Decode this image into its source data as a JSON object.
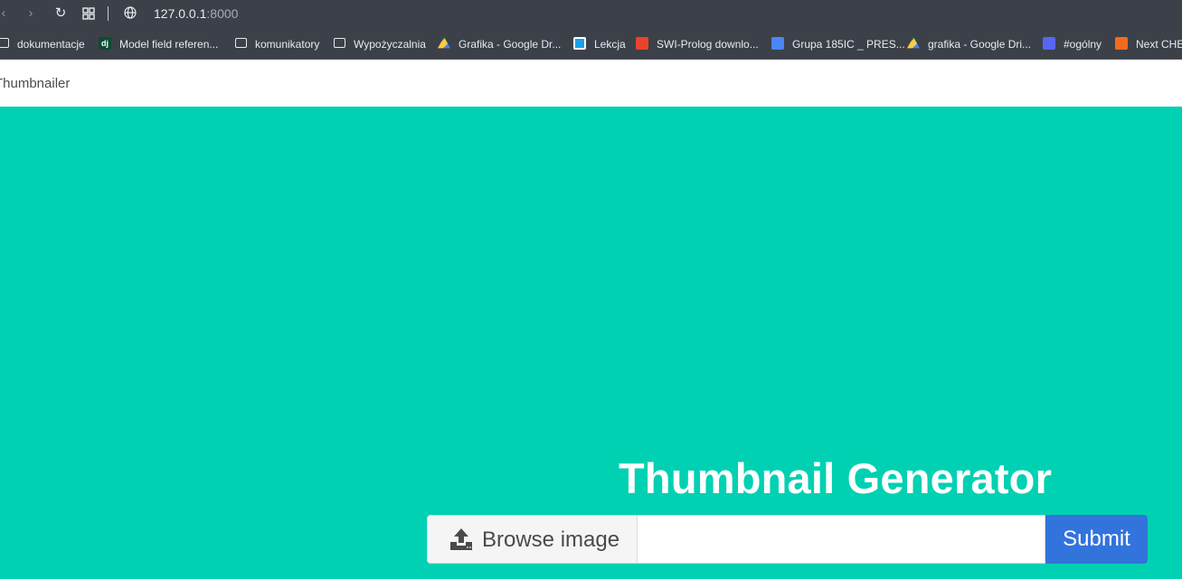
{
  "browser": {
    "url_host": "127.0.0.1",
    "url_port": ":8000",
    "bookmarks": [
      {
        "label": "dokumentacje",
        "icon": "folder-icon"
      },
      {
        "label": "Model field referen...",
        "icon": "django-icon"
      },
      {
        "label": "komunikatory",
        "icon": "folder-icon"
      },
      {
        "label": "Wypożyczalnia",
        "icon": "folder-icon"
      },
      {
        "label": "Grafika - Google Dr...",
        "icon": "google-drive-icon"
      },
      {
        "label": "Lekcja",
        "icon": "lekcja-icon"
      },
      {
        "label": "SWI-Prolog downlo...",
        "icon": "owl-icon"
      },
      {
        "label": "Grupa 185IC _ PRES...",
        "icon": "google-docs-icon"
      },
      {
        "label": "grafika - Google Dri...",
        "icon": "google-drive-icon"
      },
      {
        "label": "#ogólny",
        "icon": "discord-icon"
      },
      {
        "label": "Next CHE",
        "icon": "orange-circle-icon"
      }
    ]
  },
  "navbar": {
    "brand": "Thumbnailer"
  },
  "hero": {
    "title": "Thumbnail Generator",
    "browse_label": "Browse image",
    "filename": "",
    "submit_label": "Submit"
  },
  "colors": {
    "hero_bg": "#00d1b2",
    "submit_bg": "#3273dc",
    "chrome_bg": "#3c4049"
  }
}
